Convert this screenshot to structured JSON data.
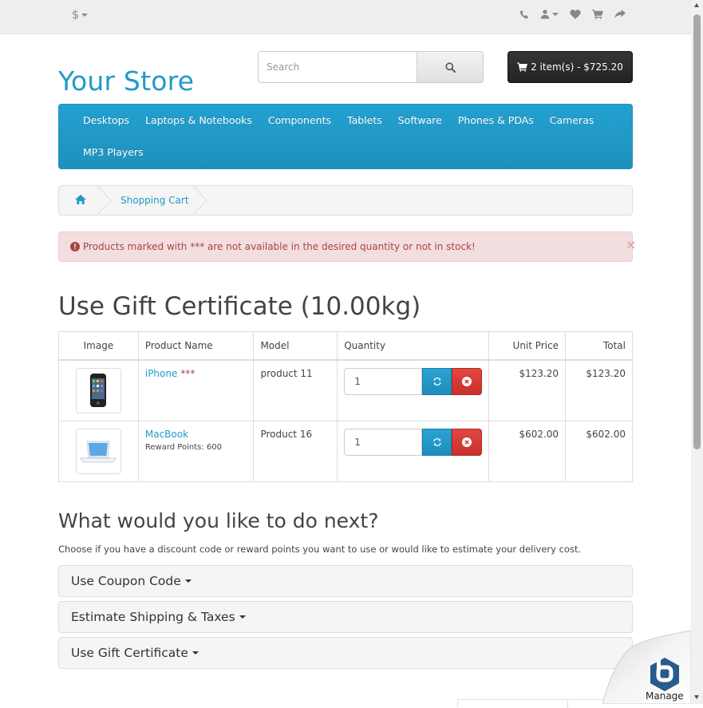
{
  "topbar": {
    "currency": "$",
    "icons": [
      "phone-icon",
      "user-icon",
      "heart-icon",
      "shopping-cart-icon",
      "share-icon"
    ]
  },
  "header": {
    "logo": "Your Store",
    "search_placeholder": "Search",
    "cart_button": "2 item(s) - $725.20"
  },
  "menu": {
    "items": [
      "Desktops",
      "Laptops & Notebooks",
      "Components",
      "Tablets",
      "Software",
      "Phones & PDAs",
      "Cameras",
      "MP3 Players"
    ]
  },
  "breadcrumb": {
    "home_icon": "home-icon",
    "current": "Shopping Cart"
  },
  "alert": {
    "message": "Products marked with *** are not available in the desired quantity or not in stock!",
    "close": "×"
  },
  "page_title": "Use Gift Certificate  (10.00kg)",
  "cart_table": {
    "headers": [
      "Image",
      "Product Name",
      "Model",
      "Quantity",
      "Unit Price",
      "Total"
    ],
    "rows": [
      {
        "name": "iPhone",
        "flag": "***",
        "reward": "",
        "model": "product 11",
        "quantity": "1",
        "unit_price": "$123.20",
        "total": "$123.20"
      },
      {
        "name": "MacBook",
        "flag": "",
        "reward": "Reward Points: 600",
        "model": "Product 16",
        "quantity": "1",
        "unit_price": "$602.00",
        "total": "$602.00"
      }
    ]
  },
  "next": {
    "title": "What would you like to do next?",
    "description": "Choose if you have a discount code or reward points you want to use or would like to estimate your delivery cost.",
    "panels": [
      "Use Coupon Code",
      "Estimate Shipping & Taxes",
      "Use Gift Certificate"
    ]
  },
  "widget": {
    "label": "Manage"
  }
}
